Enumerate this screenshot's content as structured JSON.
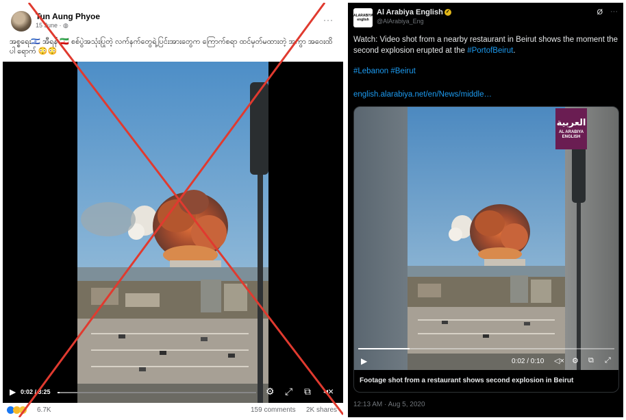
{
  "facebook_post": {
    "author": "Tun Aung Phyoe",
    "date": "15 June · ",
    "privacy_icon": "globe-icon",
    "caption": "အစ္စရေး🇮🇱 အီရန် 🇮🇷 စစ်ပွဲအသုံးပြုတဲ့ လက်နက်တွေရဲ့ပြင်းအားတွေက ကြောက်စရာ ထင်မှတ်မထားတဲ့ အကွာ အဝေးထိပါ ရောက် 😳😳",
    "more_label": "···",
    "video": {
      "time": "0:02 / 3:25",
      "progress": 0.01
    },
    "reaction_count": "6.7K",
    "reactions": [
      "like",
      "care",
      "wow"
    ],
    "comments": "159 comments",
    "shares": "2K shares",
    "overlay": "red-x-cross"
  },
  "tweet": {
    "logo_text": "ALARABIYA english",
    "account_name": "Al Arabiya English",
    "verified_icon": "gold-check-icon",
    "handle": "@AlArabiya_Eng",
    "text_prefix": "Watch: Video shot from a nearby restaurant in Beirut shows the moment the second explosion erupted at the ",
    "text_link": "#PortofBeirut",
    "text_suffix": ".",
    "hashtags": "#Lebanon #Beirut",
    "url": "english.alarabiya.net/en/News/middle…",
    "badge_arabic": "العربية",
    "badge_line1": "AL ARABIYA",
    "badge_line2": "ENGLISH",
    "video": {
      "time": "0:02 / 0:10",
      "progress": 0.2
    },
    "card_caption": "Footage shot from a restaurant shows second explosion in Beirut",
    "timestamp": "12:13 AM · Aug 5, 2020"
  },
  "colors": {
    "cross": "#e03a2f",
    "twitter_link": "#1d9bf0",
    "badge": "#6a1d52"
  }
}
